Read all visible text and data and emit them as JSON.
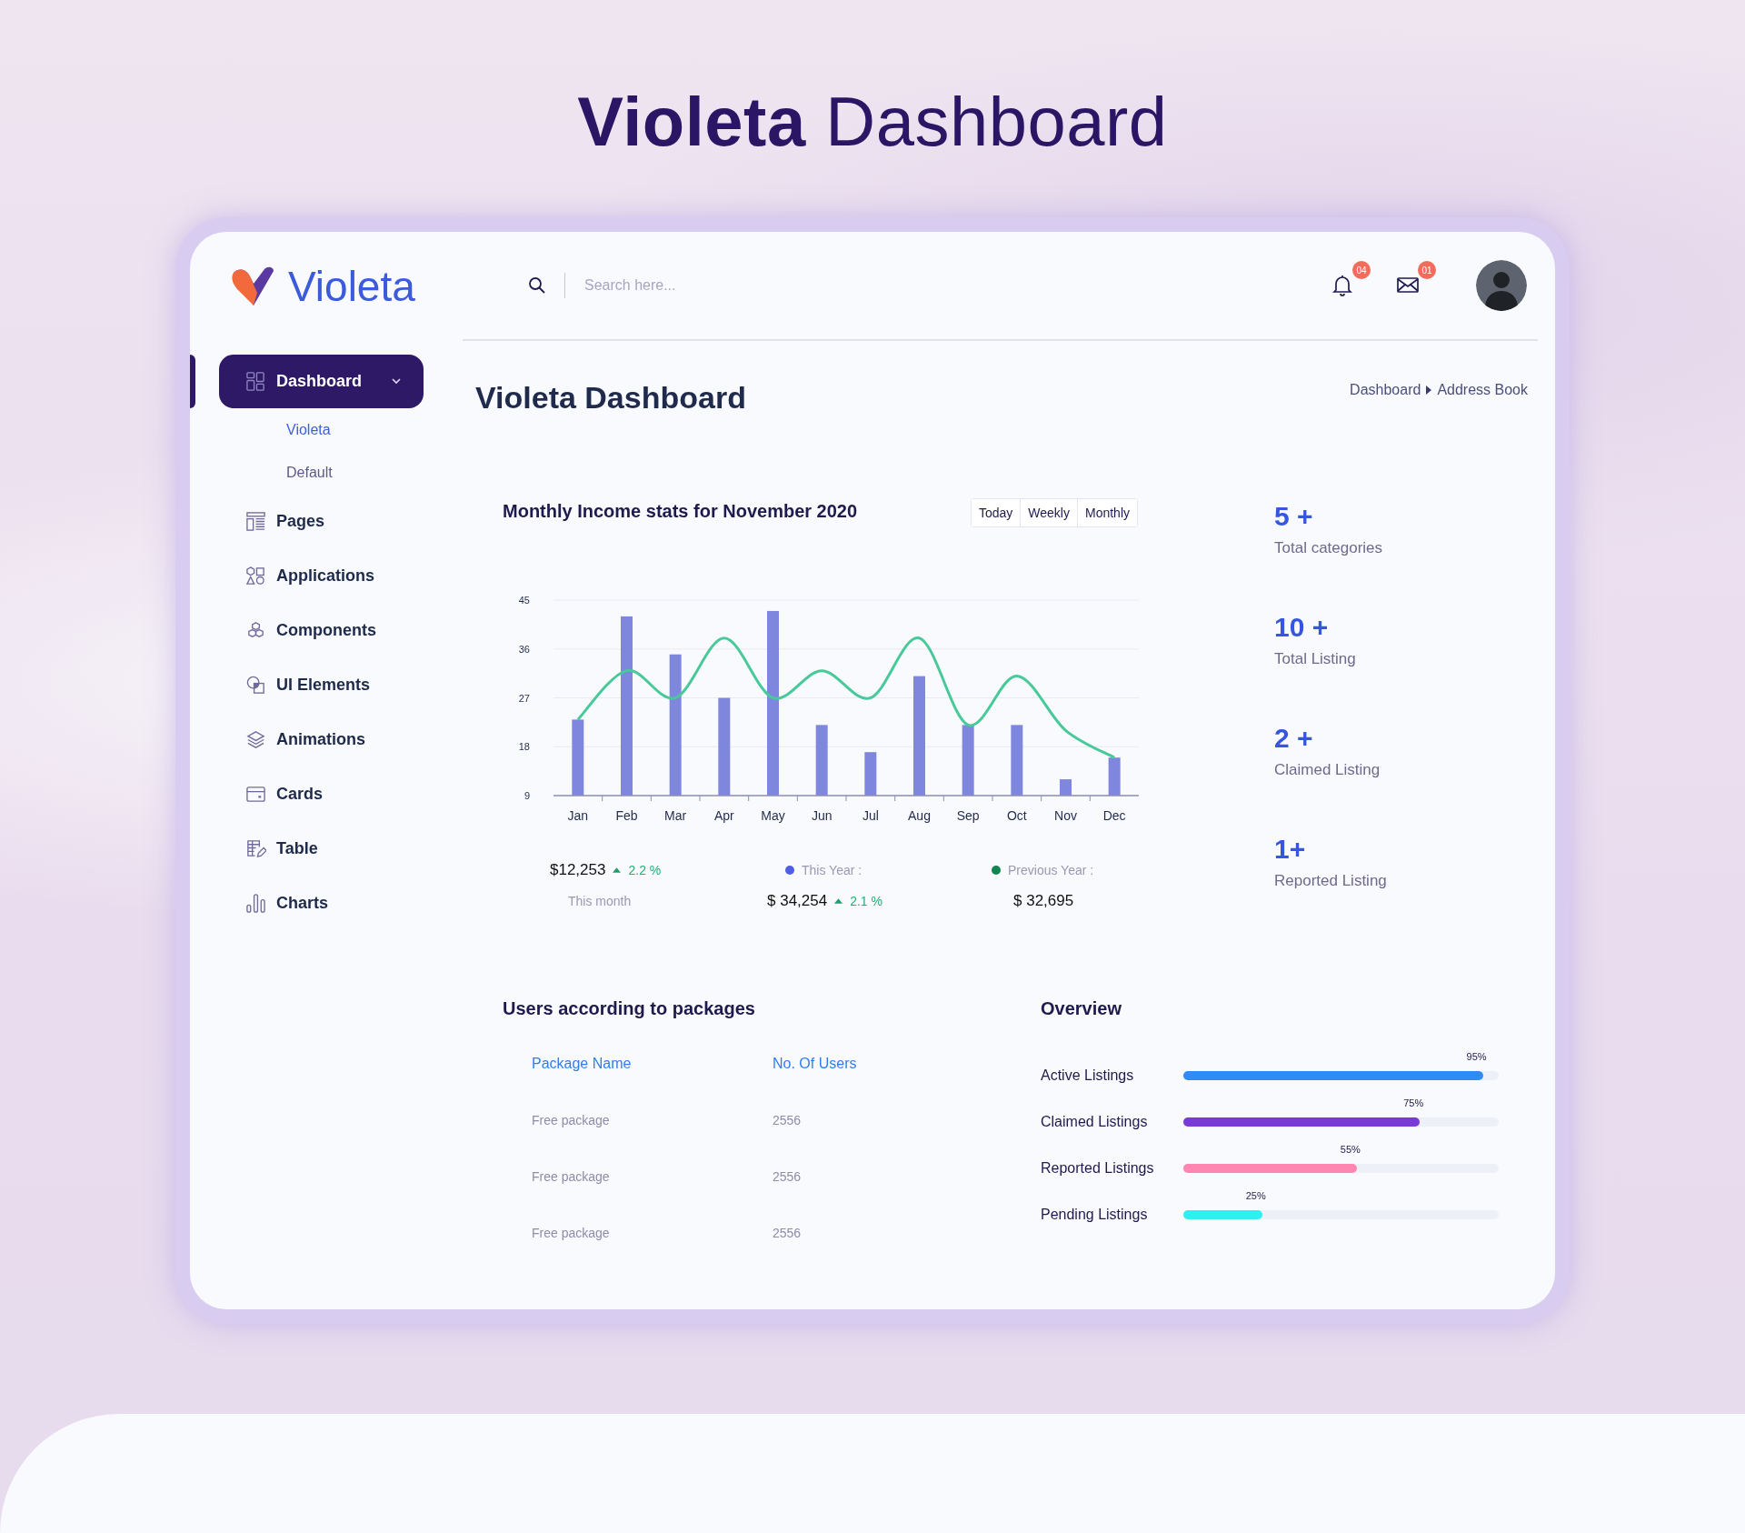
{
  "hero_title": {
    "bold": "Violeta",
    "rest": "Dashboard"
  },
  "brand": {
    "name": "Violeta"
  },
  "nav": [
    {
      "label": "Dashboard",
      "selected": true,
      "expanded": true,
      "children": [
        {
          "label": "Violeta",
          "selected": true
        },
        {
          "label": "Default",
          "selected": false
        }
      ]
    },
    {
      "label": "Pages",
      "selected": false
    },
    {
      "label": "Applications",
      "selected": false
    },
    {
      "label": "Components",
      "selected": false
    },
    {
      "label": "UI Elements",
      "selected": false
    },
    {
      "label": "Animations",
      "selected": false
    },
    {
      "label": "Cards",
      "selected": false
    },
    {
      "label": "Table",
      "selected": false
    },
    {
      "label": "Charts",
      "selected": false
    }
  ],
  "search": {
    "placeholder": "Search here..."
  },
  "notifications": {
    "badge": "04"
  },
  "messages": {
    "badge": "01"
  },
  "page_title": "Violeta Dashboard",
  "breadcrumb": [
    "Dashboard",
    "Address Book"
  ],
  "income": {
    "period_tabs": [
      "Today",
      "Weekly",
      "Monthly"
    ],
    "chart_data": {
      "type": "bar",
      "title": "Monthly Income stats for November 2020",
      "categories": [
        "Jan",
        "Feb",
        "Mar",
        "Apr",
        "May",
        "Jun",
        "Jul",
        "Aug",
        "Sep",
        "Oct",
        "Nov",
        "Dec"
      ],
      "ylim": [
        9,
        45
      ],
      "grid": true,
      "yticks": [
        9,
        18,
        27,
        36,
        45
      ],
      "series": [
        {
          "name": "This Year :",
          "color": "#7f86dd",
          "values": [
            23,
            42,
            35,
            27,
            43,
            22,
            17,
            31,
            22,
            22,
            12,
            16
          ]
        },
        {
          "name": "Previous Year :",
          "type": "line",
          "color": "#48c99a",
          "values": [
            23,
            32,
            27,
            38,
            27,
            32,
            27,
            38,
            22,
            31,
            21,
            16
          ]
        }
      ]
    },
    "summary": {
      "this_month": {
        "value": "$12,253",
        "change": "2.2 %",
        "label": "This month"
      },
      "this_year": {
        "value": "$ 34,254",
        "change": "2.1 %"
      },
      "previous_year": {
        "value": "$ 32,695"
      }
    }
  },
  "stats": [
    {
      "value": "5 +",
      "label": "Total categories"
    },
    {
      "value": "10 +",
      "label": "Total Listing"
    },
    {
      "value": "2 +",
      "label": "Claimed Listing"
    },
    {
      "value": "1+",
      "label": "Reported Listing"
    }
  ],
  "packages": {
    "title": "Users according to packages",
    "columns": [
      "Package Name",
      "No. Of Users"
    ],
    "rows": [
      [
        "Free package",
        "2556"
      ],
      [
        "Free package",
        "2556"
      ],
      [
        "Free package",
        "2556"
      ]
    ]
  },
  "overview": {
    "title": "Overview",
    "items": [
      {
        "label": "Active Listings",
        "level": 0.95,
        "reading": "95%",
        "color": "#2f8cf4"
      },
      {
        "label": "Claimed Listings",
        "level": 0.75,
        "reading": "75%",
        "color": "#7a3ad8"
      },
      {
        "label": "Reported Listings",
        "level": 0.55,
        "reading": "55%",
        "color": "#ff86b0"
      },
      {
        "label": "Pending Listings",
        "level": 0.25,
        "reading": "25%",
        "color": "#2ef0f0"
      }
    ]
  }
}
